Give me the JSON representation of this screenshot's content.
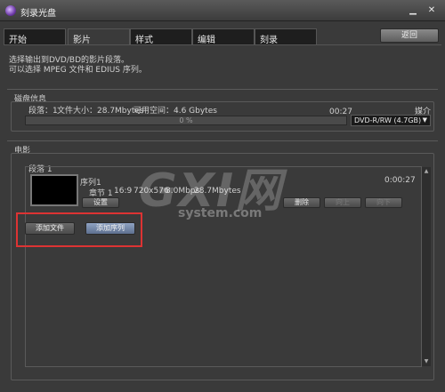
{
  "window": {
    "title": "刻录光盘",
    "icon": "disc-app-icon"
  },
  "tabs": [
    {
      "label": "开始",
      "active": false
    },
    {
      "label": "影片",
      "active": true
    },
    {
      "label": "样式",
      "active": false
    },
    {
      "label": "编辑",
      "active": false
    },
    {
      "label": "刻录",
      "active": false
    }
  ],
  "back_label": "返回",
  "info": {
    "line1": "选择输出到DVD/BD的影片段落。",
    "line2": "可以选择 MPEG 文件和 EDIUS 序列。"
  },
  "disc": {
    "section_label": "磁盘信息",
    "segment_text": "段落：1",
    "filesize_text": "文件大小：28.7Mbytes",
    "free_text": "可用空间：4.6 Gbytes",
    "time": "00:27",
    "media_label": "媒介",
    "progress_percent": 0,
    "progress_text": "0 %",
    "media_value": "DVD-R/RW (4.7GB)"
  },
  "movie": {
    "section_label": "电影",
    "segment_label": "段落 1",
    "sequence_name": "序列1",
    "chapter_text": "章节 1",
    "aspect": "16:9",
    "resolution": "720x576",
    "bitrate": "8.0Mbps",
    "size": "28.7Mbytes",
    "duration": "0:00:27",
    "settings_label": "设置",
    "delete_label": "删除",
    "up_label": "向上",
    "down_label": "向下",
    "add_file_label": "添加文件",
    "add_sequence_label": "添加序列"
  },
  "watermark": {
    "main": "GXI网",
    "sub": "system.com"
  },
  "colors": {
    "highlight": "#dd3333",
    "accent": "#6d8db8"
  }
}
